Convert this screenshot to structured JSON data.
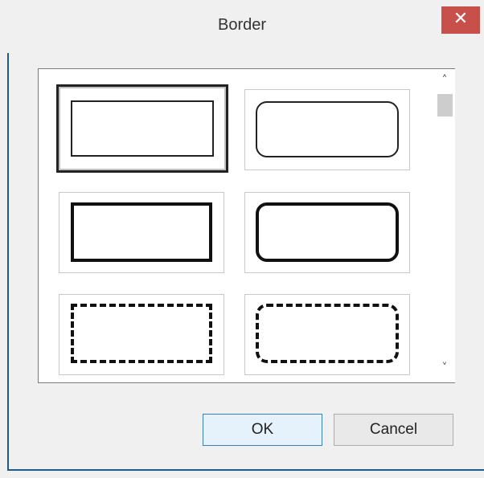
{
  "window": {
    "title": "Border",
    "close_glyph": "✕"
  },
  "borders_list": {
    "items": [
      {
        "style": "thin-square",
        "selected": true
      },
      {
        "style": "thin-rounded",
        "selected": false
      },
      {
        "style": "thick-square",
        "selected": false
      },
      {
        "style": "thick-rounded",
        "selected": false
      },
      {
        "style": "dashed-square",
        "selected": false
      },
      {
        "style": "dashed-rounded",
        "selected": false
      }
    ]
  },
  "scrollbar": {
    "up_glyph": "˄",
    "down_glyph": "˅"
  },
  "buttons": {
    "ok_label": "OK",
    "cancel_label": "Cancel"
  },
  "colors": {
    "close_button": "#c7504a",
    "frame": "#1e5a8a",
    "ok_border": "#3c7fb1"
  }
}
